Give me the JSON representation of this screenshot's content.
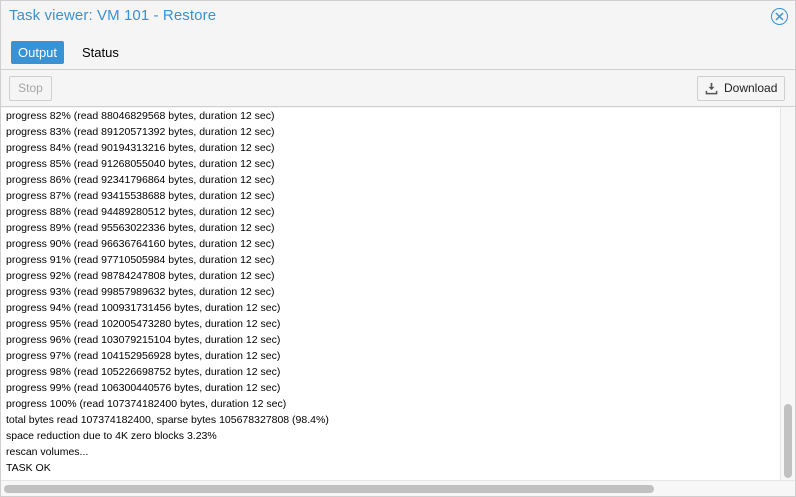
{
  "window": {
    "title": "Task viewer: VM 101 - Restore"
  },
  "tabs": [
    {
      "label": "Output",
      "active": true
    },
    {
      "label": "Status",
      "active": false
    }
  ],
  "toolbar": {
    "stop_label": "Stop",
    "download_label": "Download"
  },
  "log": {
    "lines": [
      "progress 82% (read 88046829568 bytes, duration 12 sec)",
      "progress 83% (read 89120571392 bytes, duration 12 sec)",
      "progress 84% (read 90194313216 bytes, duration 12 sec)",
      "progress 85% (read 91268055040 bytes, duration 12 sec)",
      "progress 86% (read 92341796864 bytes, duration 12 sec)",
      "progress 87% (read 93415538688 bytes, duration 12 sec)",
      "progress 88% (read 94489280512 bytes, duration 12 sec)",
      "progress 89% (read 95563022336 bytes, duration 12 sec)",
      "progress 90% (read 96636764160 bytes, duration 12 sec)",
      "progress 91% (read 97710505984 bytes, duration 12 sec)",
      "progress 92% (read 98784247808 bytes, duration 12 sec)",
      "progress 93% (read 99857989632 bytes, duration 12 sec)",
      "progress 94% (read 100931731456 bytes, duration 12 sec)",
      "progress 95% (read 102005473280 bytes, duration 12 sec)",
      "progress 96% (read 103079215104 bytes, duration 12 sec)",
      "progress 97% (read 104152956928 bytes, duration 12 sec)",
      "progress 98% (read 105226698752 bytes, duration 12 sec)",
      "progress 99% (read 106300440576 bytes, duration 12 sec)",
      "progress 100% (read 107374182400 bytes, duration 12 sec)",
      "total bytes read 107374182400, sparse bytes 105678327808 (98.4%)",
      "space reduction due to 4K zero blocks 3.23%",
      "rescan volumes...",
      "TASK OK"
    ]
  },
  "icons": {
    "close": "close-circle-icon",
    "download": "download-icon"
  },
  "colors": {
    "accent": "#3892d4",
    "disabled_text": "#a5a5a5"
  }
}
